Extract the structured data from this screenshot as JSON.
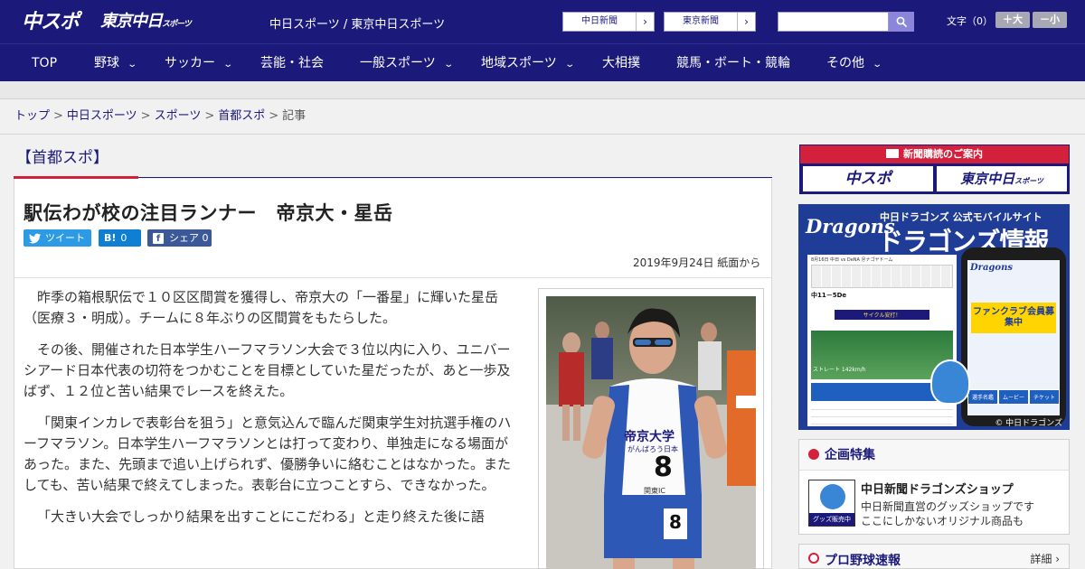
{
  "header": {
    "logo_chuspo": "中スポ",
    "logo_tokyo": "東京中日",
    "logo_tokyo_suffix": "スポーツ",
    "tagline": "中日スポーツ / 東京中日スポーツ",
    "paper_links": [
      {
        "label": "中日新聞"
      },
      {
        "label": "東京新聞"
      }
    ],
    "search_placeholder": "",
    "font_label": "文字（0）",
    "font_plus": "＋大",
    "font_minus": "－小"
  },
  "nav": [
    {
      "label": "TOP",
      "has_menu": false
    },
    {
      "label": "野球",
      "has_menu": true
    },
    {
      "label": "サッカー",
      "has_menu": true
    },
    {
      "label": "芸能・社会",
      "has_menu": false
    },
    {
      "label": "一般スポーツ",
      "has_menu": true
    },
    {
      "label": "地域スポーツ",
      "has_menu": true
    },
    {
      "label": "大相撲",
      "has_menu": false
    },
    {
      "label": "競馬・ボート・競輪",
      "has_menu": false
    },
    {
      "label": "その他",
      "has_menu": true
    }
  ],
  "breadcrumb": [
    {
      "label": "トップ",
      "link": true
    },
    {
      "label": "中日スポーツ",
      "link": true
    },
    {
      "label": "スポーツ",
      "link": true
    },
    {
      "label": "首都スポ",
      "link": true
    },
    {
      "label": "記事",
      "link": false
    }
  ],
  "article": {
    "section": "【首都スポ】",
    "headline": "駅伝わが校の注目ランナー　帝京大・星岳",
    "share": {
      "tweet": "ツイート",
      "hatena_icon": "B!",
      "hatena_count": "0",
      "facebook_icon": "f",
      "facebook_label": "シェア",
      "facebook_count": "0"
    },
    "date": "2019年9月24日 紙面から",
    "paragraphs": [
      "昨季の箱根駅伝で１０区区間賞を獲得し、帝京大の「一番星」に輝いた星岳（医療３・明成）。チームに８年ぶりの区間賞をもたらした。",
      "その後、開催された日本学生ハーフマラソン大会で３位以内に入り、ユニバーシアード日本代表の切符をつかむことを目標としていた星だったが、あと一歩及ばず、１２位と苦い結果でレースを終えた。",
      "「関東インカレで表彰台を狙う」と意気込んで臨んだ関東学生対抗選手権のハーフマラソン。日本学生ハーフマラソンとは打って変わり、単独走になる場面があった。また、先頭まで追い上げられず、優勝争いに絡むことはなかった。またしても、苦い結果で終えてしまった。表彰台に立つことすら、できなかった。",
      "「大きい大会でしっかり結果を出すことにこだわる」と走り終えた後に語"
    ],
    "photo": {
      "bib_school": "帝京大学",
      "bib_sub": "がんばろう日本",
      "bib_number": "8",
      "bib_sponsor": "関東IC"
    }
  },
  "sidebar": {
    "subscribe": {
      "heading": "新聞購読のご案内",
      "logo_chuspo": "中スポ",
      "logo_tokyo": "東京中日",
      "logo_tokyo_suffix": "スポーツ"
    },
    "dragons_ad": {
      "brand": "Dragons",
      "subtitle": "中日ドラゴンズ 公式モバイルサイト",
      "title": "ドラゴンズ情報",
      "score_title": "8月16日 中日 vs DeNA ＠ナゴヤドーム",
      "score_line": "中11－5De",
      "cycle": "サイクル安打！",
      "pitch": "ストレート 142km/h",
      "phone_brand": "Dragons",
      "phone_banner": "ファンクラブ会員募集中",
      "copyright": "© 中日ドラゴンズ",
      "menu_items": [
        "選手名鑑",
        "ムービー",
        "チケット"
      ]
    },
    "feature": {
      "heading": "企画特集",
      "item_title": "中日新聞ドラゴンズショップ",
      "item_desc1": "中日新聞直営のグッズショップです",
      "item_desc2": "ここにしかないオリジナル商品も",
      "thumb_label": "グッズ販売中"
    },
    "pro_baseball": {
      "heading": "プロ野球速報",
      "more": "詳細"
    }
  },
  "colors": {
    "navy": "#1b1a7a",
    "red": "#d4213b",
    "twitter": "#2d9be3",
    "hatena": "#0e7fd2",
    "facebook": "#3b5998"
  },
  "icons": {
    "search": "search-icon",
    "chevron": "chevron-down-icon",
    "arrow": "chevron-right-icon"
  }
}
